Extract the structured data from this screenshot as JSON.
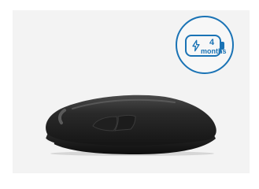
{
  "battery_badge": {
    "duration_value": "4",
    "duration_unit": "months",
    "color": "#1a73b5"
  },
  "product": {
    "name": "mouse-icon"
  },
  "icons": {
    "bolt": "lightning-bolt-icon",
    "battery": "battery-icon"
  }
}
